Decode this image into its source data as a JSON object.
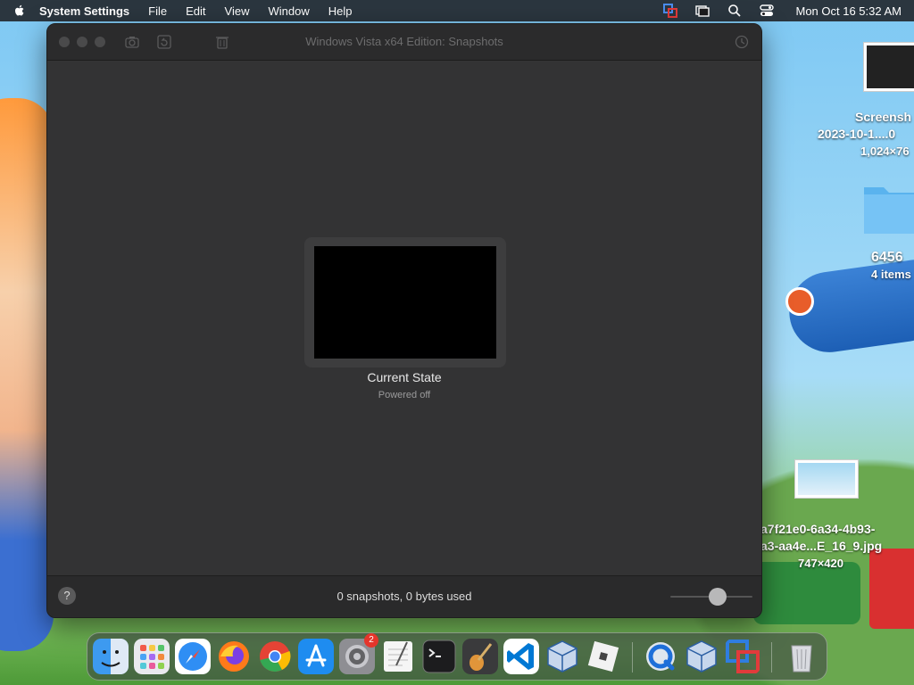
{
  "menubar": {
    "app_name": "System Settings",
    "menus": [
      "File",
      "Edit",
      "View",
      "Window",
      "Help"
    ],
    "clock": "Mon Oct 16  5:32 AM"
  },
  "desktop": {
    "items": [
      {
        "name": "Screensh",
        "line2": "2023-10-1....0",
        "sub": "1,024×76"
      },
      {
        "name": "6456",
        "sub": "4 items"
      },
      {
        "name": "a7f21e0-6a34-4b93-",
        "line2": "a3-aa4e...E_16_9.jpg",
        "sub": "747×420"
      }
    ]
  },
  "window": {
    "title": "Windows Vista x64 Edition: Snapshots",
    "snapshot": {
      "title": "Current State",
      "subtitle": "Powered off"
    },
    "status": "0 snapshots, 0 bytes used",
    "help_label": "?",
    "zoom_level": 0.6
  },
  "dock": {
    "settings_badge": "2",
    "apps": [
      "finder",
      "launchpad",
      "safari",
      "firefox",
      "chrome",
      "app-store",
      "system-settings",
      "textedit",
      "terminal",
      "garageband",
      "vscode",
      "virtualbox",
      "roblox",
      "quicktime",
      "virtualbox-2",
      "parallels",
      "trash"
    ]
  },
  "colors": {
    "window_bg": "#333334",
    "titlebar_bg": "#2b2b2c",
    "accent_blue": "#1e8cf0"
  }
}
